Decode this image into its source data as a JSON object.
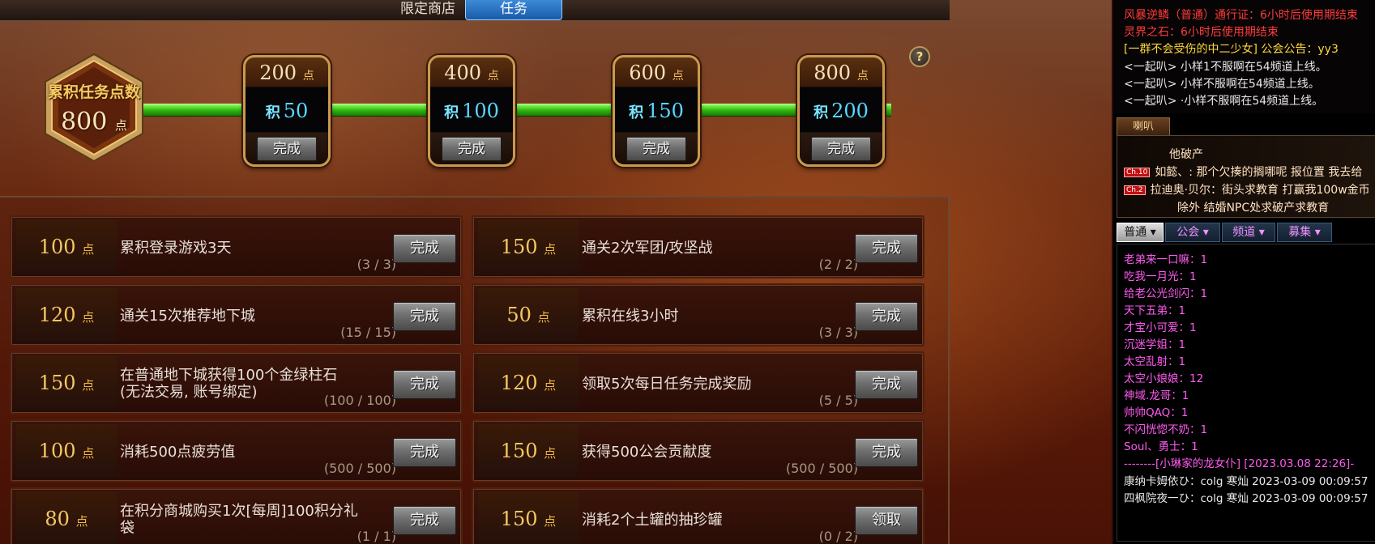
{
  "topbar": {
    "tab_shop": "限定商店",
    "tab_task": "任务"
  },
  "help_glyph": "?",
  "total": {
    "label": "累积任务点数",
    "value": "800",
    "unit": "点"
  },
  "milestones": [
    {
      "points": "200",
      "unit": "点",
      "reward_prefix": "积",
      "reward": "50",
      "button": "完成"
    },
    {
      "points": "400",
      "unit": "点",
      "reward_prefix": "积",
      "reward": "100",
      "button": "完成"
    },
    {
      "points": "600",
      "unit": "点",
      "reward_prefix": "积",
      "reward": "150",
      "button": "完成"
    },
    {
      "points": "800",
      "unit": "点",
      "reward_prefix": "积",
      "reward": "200",
      "button": "完成"
    }
  ],
  "tasks": [
    {
      "points": "100",
      "unit": "点",
      "desc": "累积登录游戏3天",
      "progress": "(3 / 3)",
      "button": "完成"
    },
    {
      "points": "150",
      "unit": "点",
      "desc": "通关2次军团/攻坚战",
      "progress": "(2 / 2)",
      "button": "完成"
    },
    {
      "points": "120",
      "unit": "点",
      "desc": "通关15次推荐地下城",
      "progress": "(15 / 15)",
      "button": "完成"
    },
    {
      "points": "50",
      "unit": "点",
      "desc": "累积在线3小时",
      "progress": "(3 / 3)",
      "button": "完成"
    },
    {
      "points": "150",
      "unit": "点",
      "desc": "在普通地下城获得100个金绿柱石(无法交易, 账号绑定)",
      "progress": "(100 / 100)",
      "button": "完成"
    },
    {
      "points": "120",
      "unit": "点",
      "desc": "领取5次每日任务完成奖励",
      "progress": "(5 / 5)",
      "button": "完成"
    },
    {
      "points": "100",
      "unit": "点",
      "desc": "消耗500点疲劳值",
      "progress": "(500 / 500)",
      "button": "完成"
    },
    {
      "points": "150",
      "unit": "点",
      "desc": "获得500公会贡献度",
      "progress": "(500 / 500)",
      "button": "完成"
    },
    {
      "points": "80",
      "unit": "点",
      "desc": "在积分商城购买1次[每周]100积分礼袋",
      "progress": "(1 / 1)",
      "button": "完成"
    },
    {
      "points": "150",
      "unit": "点",
      "desc": "消耗2个土罐的抽珍罐",
      "progress": "(0 / 2)",
      "button": "领取"
    }
  ],
  "side": {
    "sys_lines": [
      "风暴逆鳞（普通）通行证：6小时后使用期结束",
      "灵界之石：6小时后使用期结束",
      "[一群不会受伤的中二少女] 公会公告：yy3",
      "<一起叭> 小样1不服啊在54频道上线。",
      "<一起叭> 小样不服啊在54频道上线。",
      "<一起叭> ·小样不服啊在54频道上线。"
    ],
    "horn_tab": "喇叭",
    "horn_lines": [
      {
        "badge": "",
        "text": "他破产"
      },
      {
        "badge": "Ch.10",
        "text": "如懿、: 那个欠揍的搁哪呢 报位置 我去给"
      },
      {
        "badge": "Ch.2",
        "text": "拉迪奥·贝尔：街头求教育 打赢我100w金币"
      },
      {
        "badge": "",
        "text": "除外 结婚NPC处求破产求教育"
      }
    ],
    "chat_tabs": [
      "普通 ▾",
      "公会 ▾",
      "频道 ▾",
      "募集 ▾"
    ],
    "chat_lines": [
      "老弟来一口嘛：1",
      "吃我一月光：1",
      "给老公光剑闪：1",
      "天下五弟：1",
      "才宝小可爱：1",
      "沉迷学姐：1",
      "太空乱射：1",
      "太空小娘娘：12",
      "神域.龙哥：1",
      "帅帅QAQ：1",
      "不闪恍惚不奶：1",
      "Soul、勇士：1",
      "--------[小琳家的龙女仆] [2023.03.08 22:26]-",
      "康纳卡姆依ひ：colg 寒灿 2023-03-09 00:09:57",
      "四枫院夜一ひ：colg 寒灿 2023-03-09 00:09:57"
    ]
  },
  "colors": {
    "accent_green": "#2db30e",
    "tab_blue": "#1a5aa8",
    "gold": "#f5c860",
    "sys_red": "#ff3a3a",
    "chat_pink": "#ff5af0"
  }
}
